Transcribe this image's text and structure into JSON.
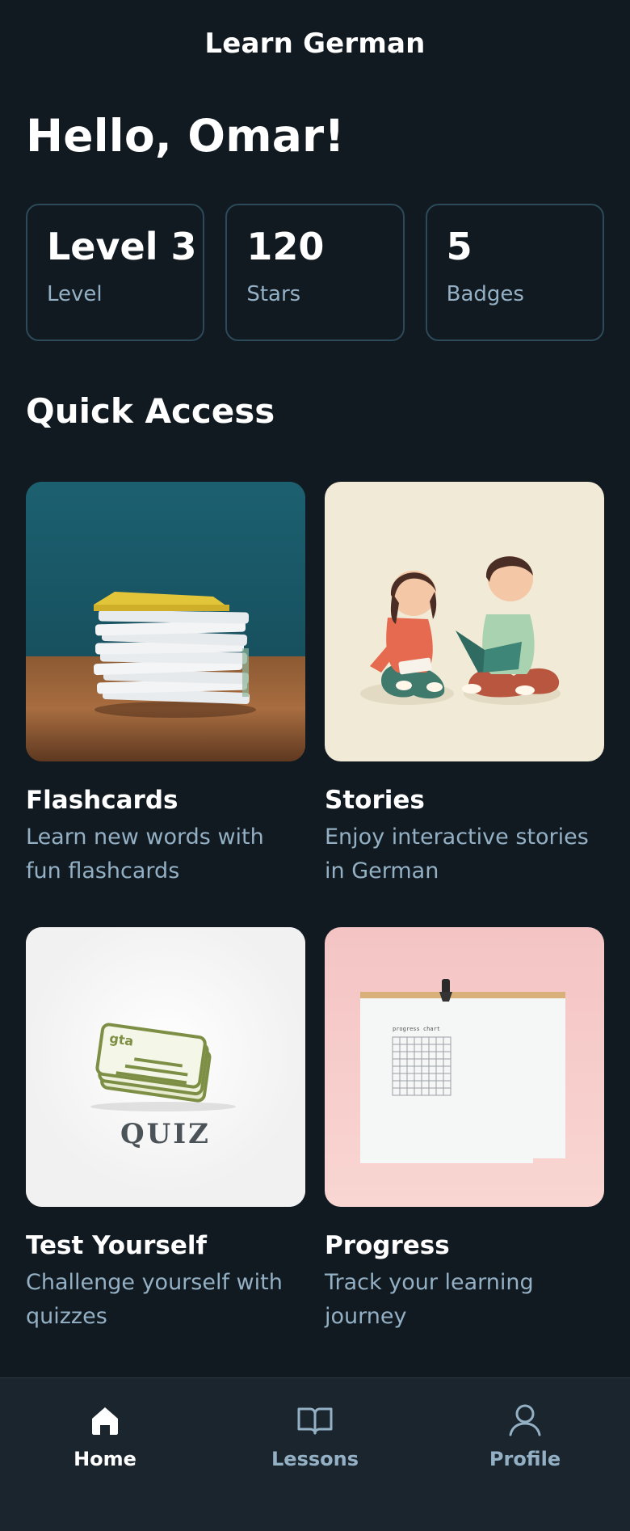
{
  "header": {
    "title": "Learn German"
  },
  "greeting": "Hello, Omar!",
  "stats": [
    {
      "value": "Level 3",
      "label": "Level"
    },
    {
      "value": "120",
      "label": "Stars"
    },
    {
      "value": "5",
      "label": "Badges"
    }
  ],
  "quick_access": {
    "title": "Quick Access",
    "cards": [
      {
        "title": "Flashcards",
        "description": "Learn new words with fun flashcards",
        "image": "flashcards-stack-image"
      },
      {
        "title": "Stories",
        "description": "Enjoy interactive stories in German",
        "image": "children-reading-image"
      },
      {
        "title": "Test Yourself",
        "description": "Challenge yourself with quizzes",
        "image": "quiz-image"
      },
      {
        "title": "Progress",
        "description": "Track your learning journey",
        "image": "progress-chart-image"
      }
    ]
  },
  "quiz_image_text": "QUIZ",
  "bottom_nav": {
    "items": [
      {
        "label": "Home",
        "icon": "home-icon",
        "active": true
      },
      {
        "label": "Lessons",
        "icon": "book-icon",
        "active": false
      },
      {
        "label": "Profile",
        "icon": "user-icon",
        "active": false
      }
    ]
  },
  "colors": {
    "background": "#121a21",
    "nav_background": "#1b252e",
    "card_border": "#2c4a59",
    "muted_text": "#93b0c5",
    "text": "#ffffff"
  }
}
